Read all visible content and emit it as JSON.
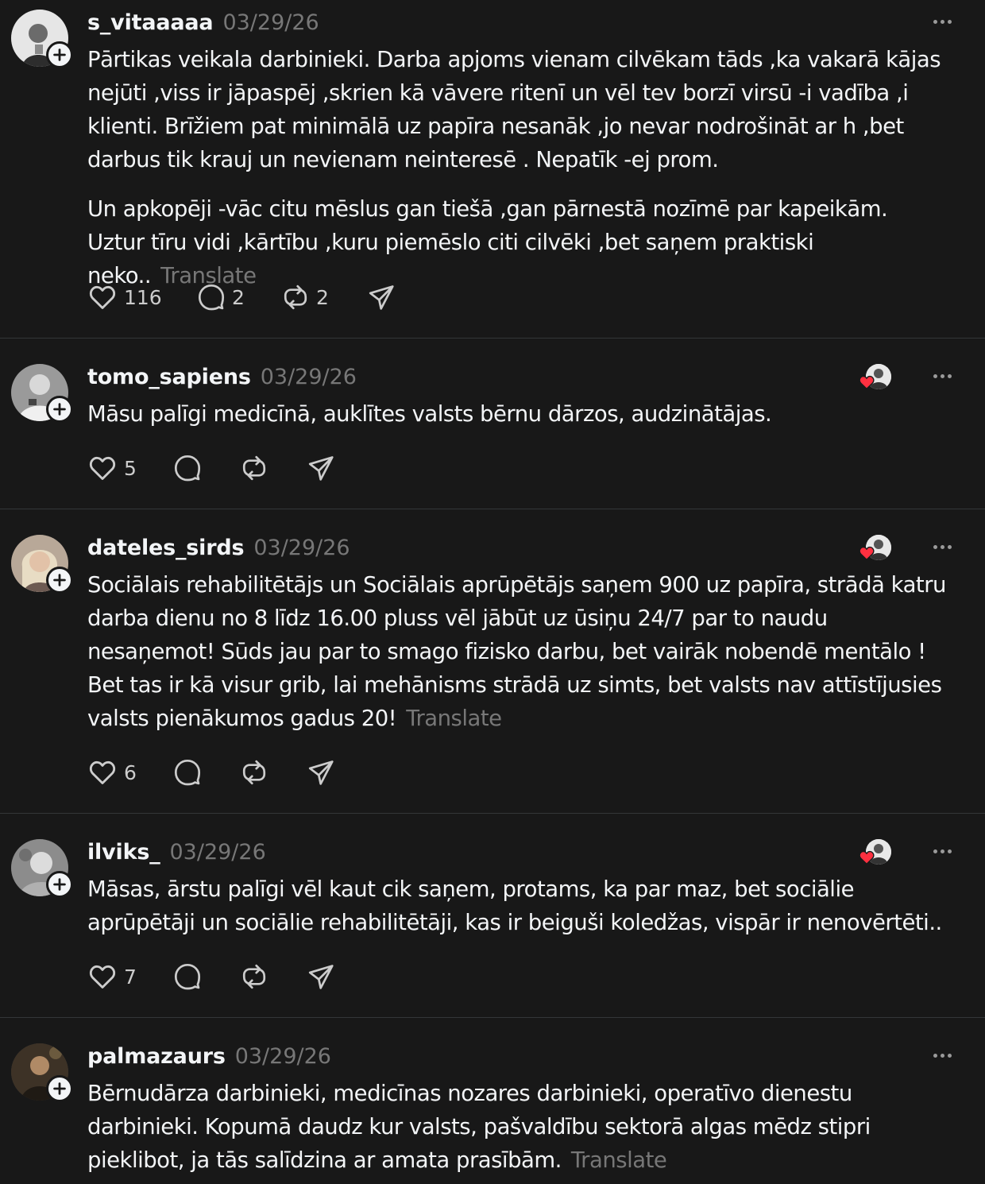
{
  "posts": [
    {
      "username": "s_vitaaaaa",
      "date": "03/29/26",
      "paragraphs": [
        "Pārtikas veikala darbinieki. Darba apjoms vienam cilvēkam tāds ,ka vakarā kājas nejūti ,viss ir jāpaspēj ,skrien kā vāvere ritenī un vēl tev borzī virsū -i vadība ,i klienti. Brīžiem pat minimālā uz papīra nesanāk ,jo nevar nodrošināt ar h ,bet darbus tik krauj un nevienam neinteresē . Nepatīk -ej prom.",
        "Un apkopēji -vāc citu mēslus gan tiešā ,gan pārnestā nozīmē par kapeikām. Uztur tīru vidi ,kārtību ,kuru piemēslo citi cilvēki ,bet saņem praktiski neko.."
      ],
      "translate": "Translate",
      "likes": "116",
      "replies": "2",
      "reposts": "2"
    },
    {
      "username": "tomo_sapiens",
      "date": "03/29/26",
      "paragraphs": [
        "Māsu palīgi medicīnā, auklītes valsts bērnu dārzos, audzinātājas."
      ],
      "likes": "5",
      "replies": "",
      "reposts": ""
    },
    {
      "username": "dateles_sirds",
      "date": "03/29/26",
      "paragraphs": [
        "Sociālais rehabilitētājs un Sociālais aprūpētājs saņem 900 uz papīra, strādā katru darba dienu no 8 līdz 16.00 pluss vēl jābūt uz ūsiņu 24/7 par to naudu nesaņemot! Sūds jau par to smago fizisko darbu, bet vairāk nobendē mentālo ! Bet tas ir kā visur grib, lai mehānisms strādā uz simts, bet valsts nav attīstījusies valsts pienākumos gadus 20!"
      ],
      "translate": "Translate",
      "likes": "6",
      "replies": "",
      "reposts": ""
    },
    {
      "username": "ilviks_",
      "date": "03/29/26",
      "paragraphs": [
        "Māsas, ārstu palīgi vēl kaut cik saņem, protams, ka par maz, bet sociālie aprūpētāji un sociālie rehabilitētāji, kas ir beiguši koledžas, vispār ir nenovērtēti.."
      ],
      "likes": "7",
      "replies": "",
      "reposts": ""
    },
    {
      "username": "palmazaurs",
      "date": "03/29/26",
      "paragraphs": [
        "Bērnudārza darbinieki, medicīnas nozares darbinieki, operatīvo dienestu darbinieki. Kopumā daudz kur valsts, pašvaldību sektorā algas mēdz stipri pieklibot, ja tās salīdzina ar amata prasībām."
      ],
      "translate": "Translate"
    }
  ],
  "colors": {
    "background": "#181818",
    "text": "#f3f5f7",
    "muted": "#777777",
    "divider": "#333638",
    "heart_red": "#ff3040"
  },
  "icons": [
    "heart-icon",
    "comment-icon",
    "repost-icon",
    "share-icon",
    "more-icon",
    "plus-icon"
  ]
}
